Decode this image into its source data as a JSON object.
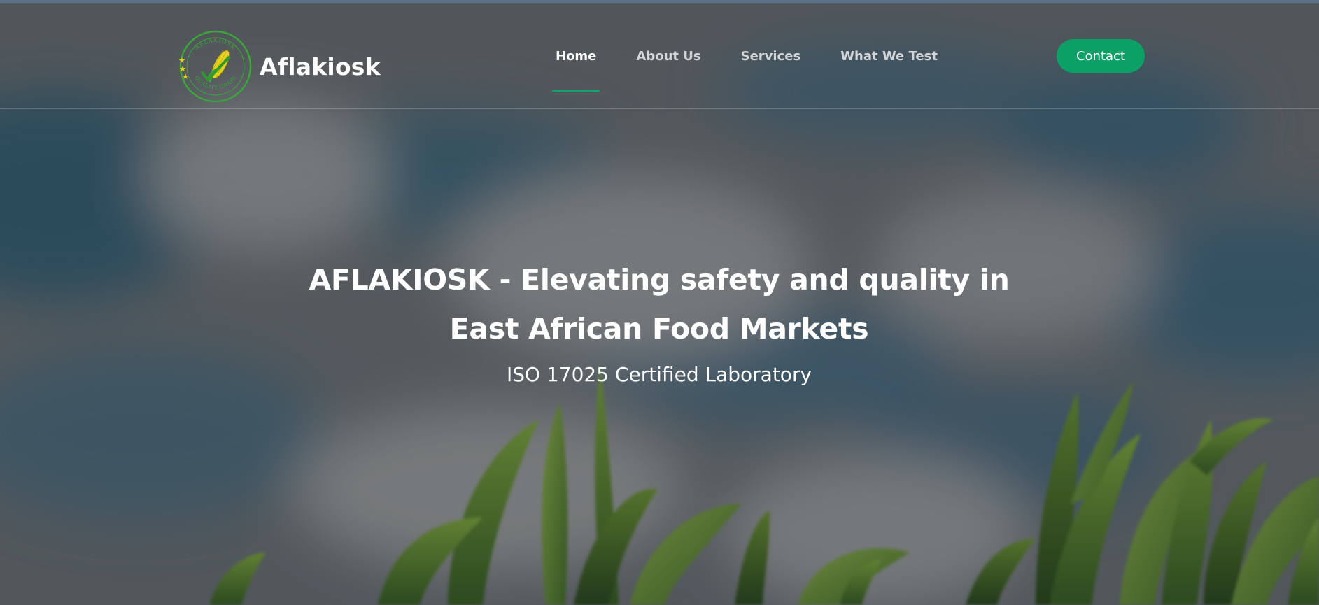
{
  "brand": {
    "name": "Aflakiosk",
    "logo_ring_text_top": "AFLAKIOSK",
    "logo_ring_text_bottom": "QUALITY GRAIN"
  },
  "nav": {
    "items": [
      {
        "label": "Home",
        "active": true
      },
      {
        "label": "About Us",
        "active": false
      },
      {
        "label": "Services",
        "active": false
      },
      {
        "label": "What We Test",
        "active": false
      }
    ]
  },
  "header": {
    "contact_label": "Contact"
  },
  "hero": {
    "title": "AFLAKIOSK - Elevating safety and quality in East African Food Markets",
    "subtitle": "ISO 17025 Certified Laboratory"
  },
  "colors": {
    "accent": "#0aa066",
    "nav_active_underline": "#11a36b",
    "logo_green": "#3aa63a",
    "logo_yellow": "#e6d21a"
  },
  "icons": {
    "logo": "corn-checkmark-badge-icon"
  }
}
